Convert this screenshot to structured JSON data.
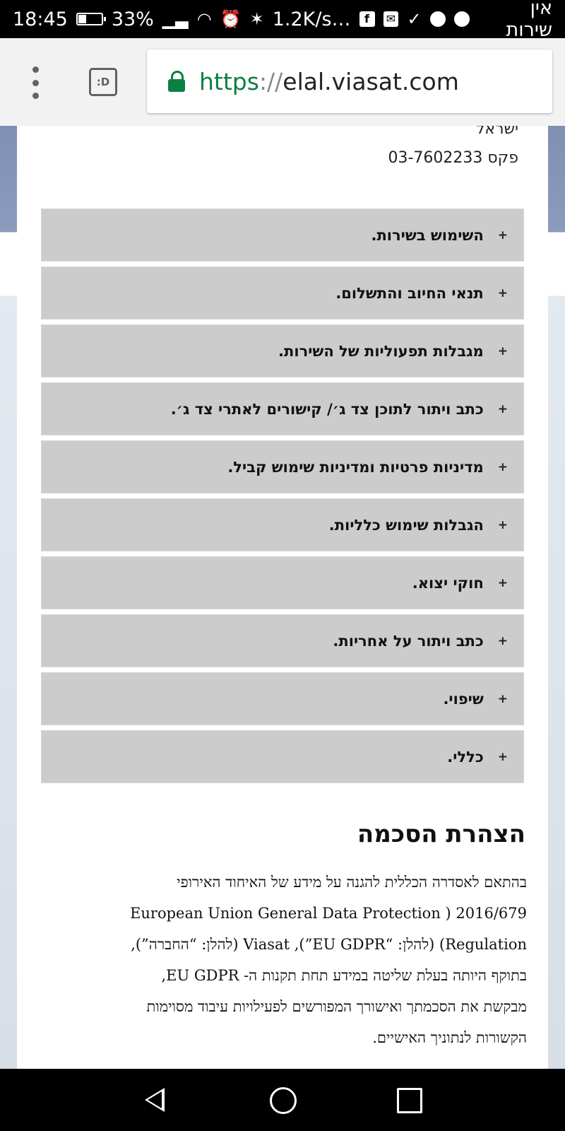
{
  "status_bar": {
    "time": "18:45",
    "battery": "33%",
    "battery_level": 0.33,
    "network_speed": "1.2K/s",
    "overflow": "…",
    "carrier": "אין שירות",
    "icons": [
      "battery-icon",
      "no-signal-icon",
      "wifi-icon",
      "alarm-icon",
      "bluetooth-icon",
      "facebook-icon",
      "email-icon",
      "check-icon",
      "music-icon",
      "telegram-icon"
    ]
  },
  "browser": {
    "url_scheme": "https",
    "url_separator": "://",
    "url_host": "elal.viasat.com",
    "tab_switcher_label": ":D",
    "secure_color": "#0b8043"
  },
  "address": {
    "country": "ישראל",
    "fax": "פקס 03-7602233"
  },
  "accordion": {
    "expand_symbol": "+",
    "items": [
      "השימוש בשירות.",
      "תנאי החיוב והתשלום.",
      "מגבלות תפעוליות של השירות.",
      "כתב ויתור לתוכן צד ג׳/ קישורים לאתרי צד ג׳.",
      "מדיניות פרטיות ומדיניות שימוש קביל.",
      "הגבלות שימוש כלליות.",
      "חוקי יצוא.",
      "כתב ויתור על אחריות.",
      "שיפוי.",
      "כללי."
    ]
  },
  "consent": {
    "title": "הצהרת הסכמה",
    "lines": [
      "בהתאם לאסדרה הכללית להגנה על מידע של האיחוד האירופי",
      "European Union General Data Protection ) 2016/679",
      "Regulation) (להלן: “EU GDPR”), Viasat (להלן: “החברה”),",
      "בתוקף היותה בעלת שליטה במידע תחת תקנות ה- EU GDPR,",
      "מבקשת את הסכמתך ואישורך המפורשים לפעילויות עיבוד מסוימות",
      "הקשורות לנתוניך האישיים."
    ]
  },
  "nav_bar": {
    "buttons": [
      "back-icon",
      "home-icon",
      "recent-apps-icon"
    ]
  }
}
